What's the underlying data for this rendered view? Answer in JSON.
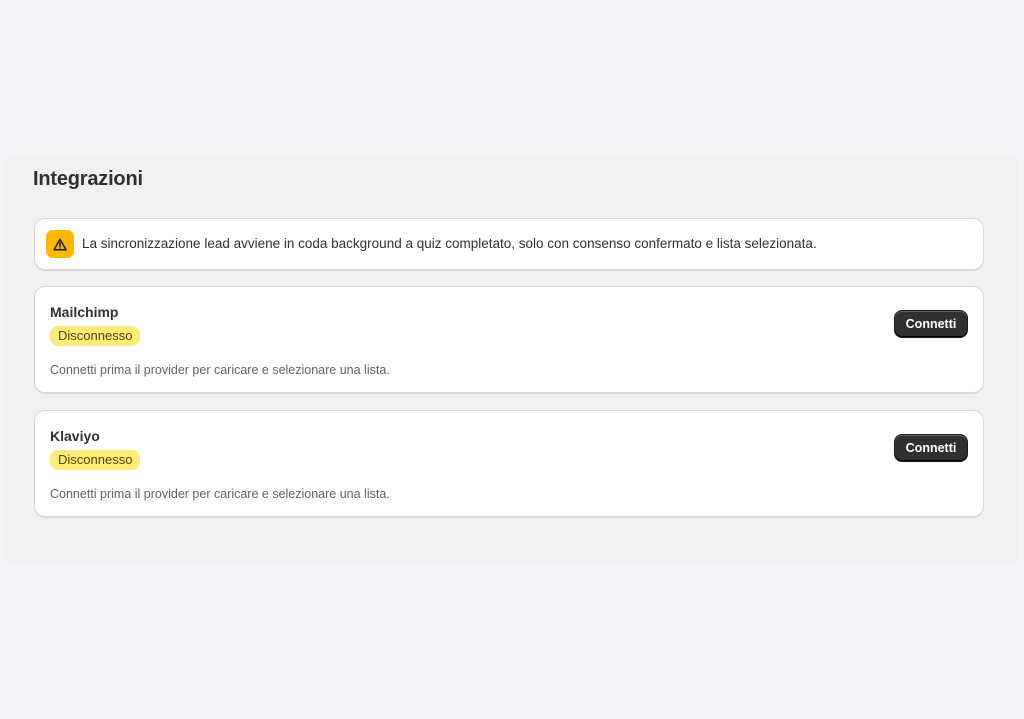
{
  "page": {
    "title": "Integrazioni"
  },
  "banner": {
    "icon": "warning-icon",
    "text": "La sincronizzazione lead avviene in coda background a quiz completato, solo con consenso confermato e lista selezionata."
  },
  "integrations": [
    {
      "name": "Mailchimp",
      "status": "Disconnesso",
      "hint": "Connetti prima il provider per caricare e selezionare una lista.",
      "button_label": "Connetti"
    },
    {
      "name": "Klaviyo",
      "status": "Disconnesso",
      "hint": "Connetti prima il provider per caricare e selezionare una lista.",
      "button_label": "Connetti"
    }
  ],
  "colors": {
    "warning": "#ffb800",
    "badge_background": "#ffeb78",
    "button_background": "#303030"
  }
}
